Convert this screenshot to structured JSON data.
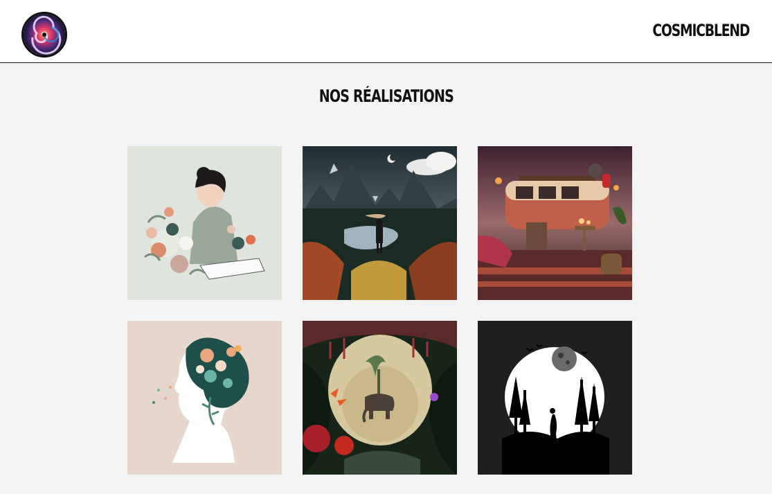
{
  "header": {
    "logo_icon": "cosmic-swirl-logo-icon",
    "brand": "COSMICBLEND"
  },
  "main": {
    "title": "NOS RÉALISATIONS"
  },
  "gallery": [
    {
      "icon": "woman-writing-with-flowers-illustration",
      "colors": [
        "#dfe5dd",
        "#1e1a1a",
        "#d98b6a"
      ]
    },
    {
      "icon": "mountain-lake-hiker-illustration",
      "colors": [
        "#1f2c33",
        "#e2a779",
        "#a24a26"
      ]
    },
    {
      "icon": "vintage-van-bohemian-terrace-illustration",
      "colors": [
        "#3d2130",
        "#c0604a",
        "#f5a548"
      ]
    },
    {
      "icon": "woman-profile-with-flower-hair-illustration",
      "colors": [
        "#e6d6cb",
        "#1e4f4b",
        "#e9a77f"
      ]
    },
    {
      "icon": "jungle-elephant-illustration",
      "colors": [
        "#172418",
        "#d6c9a0",
        "#c22a1e"
      ]
    },
    {
      "icon": "moonlit-forest-silhouette-illustration",
      "colors": [
        "#1f1f1f",
        "#ffffff",
        "#000000"
      ]
    }
  ]
}
